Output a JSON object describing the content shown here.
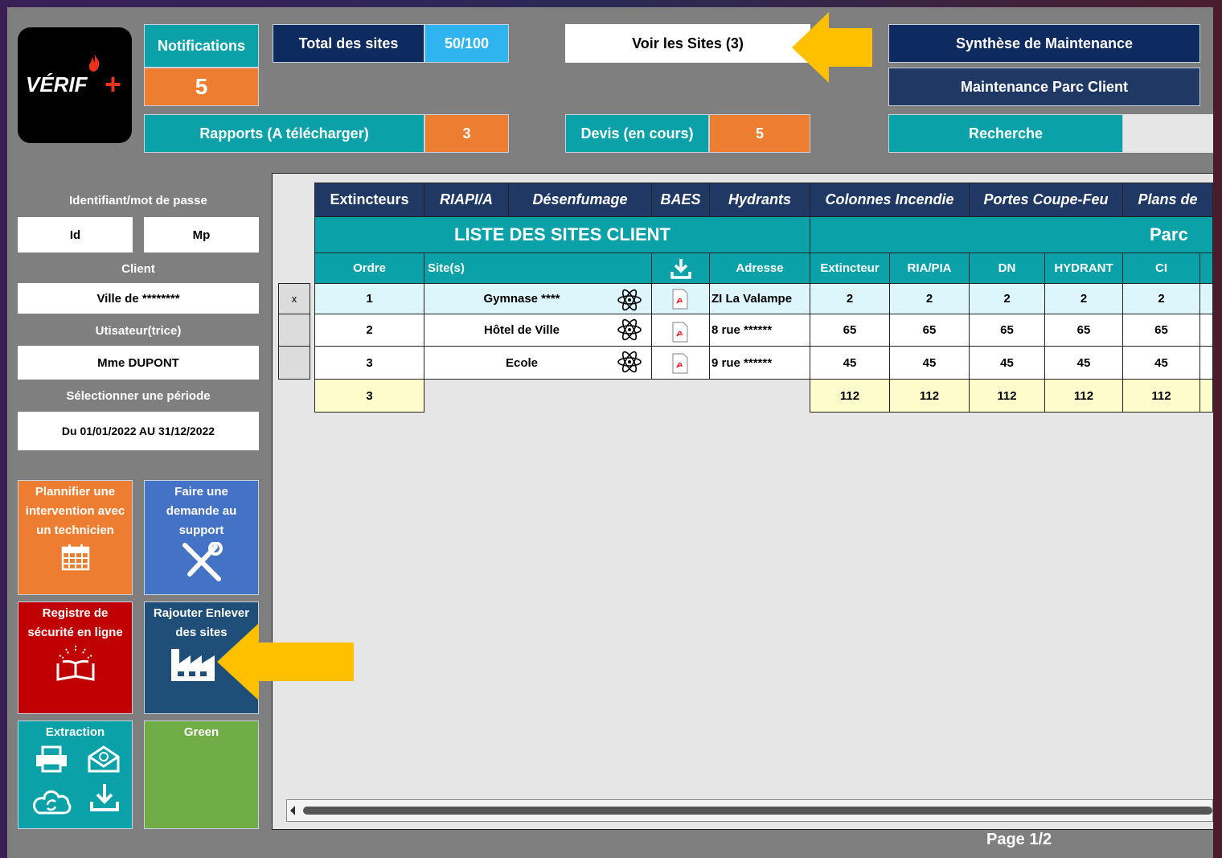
{
  "logo": {
    "text": "VÉRIF",
    "plus": "+"
  },
  "notifications": {
    "label": "Notifications",
    "count": "5"
  },
  "total_sites": {
    "label": "Total des sites",
    "value": "50/100"
  },
  "voir_sites": {
    "label": "Voir les Sites (3)"
  },
  "synthese": {
    "label": "Synthèse de Maintenance"
  },
  "maintenance_parc": {
    "label": "Maintenance Parc Client"
  },
  "rapports": {
    "label": "Rapports (A télécharger)",
    "count": "3"
  },
  "devis": {
    "label": "Devis (en cours)",
    "count": "5"
  },
  "recherche": {
    "label": "Recherche"
  },
  "left": {
    "login_label": "Identifiant/mot de passe",
    "id": "Id",
    "mp": "Mp",
    "client_label": "Client",
    "client_value": "Ville de ********",
    "user_label": "Utisateur(trice)",
    "user_value": "Mme DUPONT",
    "period_label": "Sélectionner une période",
    "period_value": "Du 01/01/2022 AU 31/12/2022"
  },
  "tiles": {
    "plan": "Plannifier une intervention avec un technicien",
    "support": "Faire une demande au support",
    "registre": "Registre de sécurité en ligne",
    "sites": "Rajouter Enlever des sites",
    "extraction": "Extraction",
    "green": "Green"
  },
  "table": {
    "categories": [
      "Extincteurs",
      "RIAPI/A",
      "Désenfumage",
      "BAES",
      "Hydrants",
      "Colonnes Incendie",
      "Portes Coupe-Feu",
      "Plans de"
    ],
    "title_sites": "LISTE DES SITES CLIENT",
    "title_parc": "Parc",
    "headers": {
      "ordre": "Ordre",
      "sites": "Site(s)",
      "adresse": "Adresse",
      "ext": "Extincteur",
      "ria": "RIA/PIA",
      "dn": "DN",
      "hyd": "HYDRANT",
      "ci": "CI"
    },
    "rows": [
      {
        "sel": "x",
        "ordre": "1",
        "site": "Gymnase ****",
        "adresse": "ZI La Valampe",
        "ext": "2",
        "ria": "2",
        "dn": "2",
        "hyd": "2",
        "ci": "2"
      },
      {
        "sel": "",
        "ordre": "2",
        "site": "Hôtel de Ville",
        "adresse": "8 rue ******",
        "ext": "65",
        "ria": "65",
        "dn": "65",
        "hyd": "65",
        "ci": "65"
      },
      {
        "sel": "",
        "ordre": "3",
        "site": "Ecole",
        "adresse": "9 rue ******",
        "ext": "45",
        "ria": "45",
        "dn": "45",
        "hyd": "45",
        "ci": "45"
      }
    ],
    "totals": {
      "ordre": "3",
      "ext": "112",
      "ria": "112",
      "dn": "112",
      "hyd": "112",
      "ci": "112"
    }
  },
  "page": {
    "label": "Page 1/2"
  },
  "colors": {
    "navy": "#0d2b5e",
    "teal": "#0aa1a8",
    "orange": "#ed7d31",
    "sky": "#2fb4f0",
    "red": "#c00000",
    "blue": "#4472c4",
    "green": "#70ad47",
    "arrow": "#ffc000"
  }
}
